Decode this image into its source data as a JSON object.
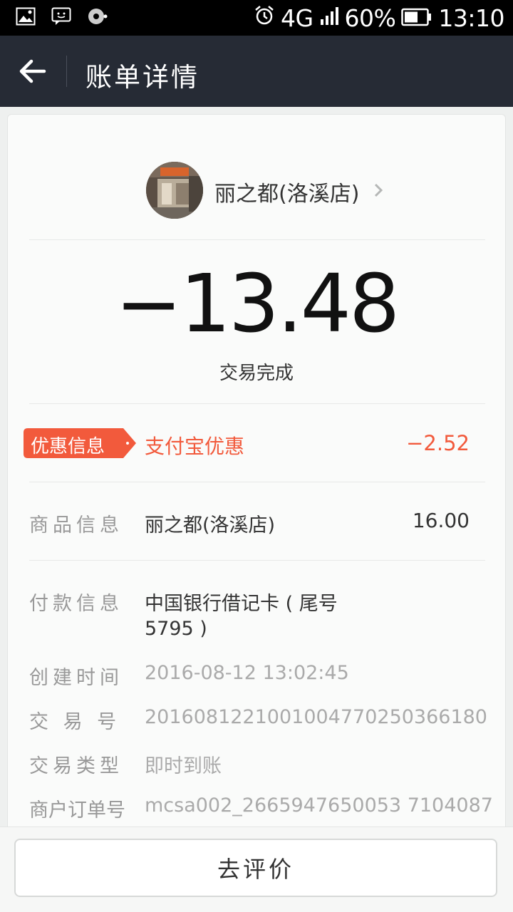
{
  "status_bar": {
    "network": "4G",
    "battery_percent": "60%",
    "time": "13:10",
    "icons": [
      "gallery-icon",
      "message-icon",
      "disk-icon",
      "alarm-icon",
      "signal-icon",
      "battery-icon"
    ]
  },
  "nav": {
    "title": "账单详情"
  },
  "merchant": {
    "name": "丽之都(洛溪店)"
  },
  "amount": "−13.48",
  "status": "交易完成",
  "promo": {
    "tag": "优惠信息",
    "source": "支付宝优惠",
    "amount": "−2.52"
  },
  "goods": {
    "label": "商品信息",
    "name": "丽之都(洛溪店)",
    "amount": "16.00"
  },
  "details": {
    "payment_label": "付款信息",
    "payment_line1": "中国银行借记卡 ( 尾号",
    "payment_line2": "5795 )",
    "created_label": "创建时间",
    "created_value": "2016-08-12 13:02:45",
    "trade_no_label": "交 易 号",
    "trade_no_value": "2016081221001004770250366180",
    "trade_type_label": "交易类型",
    "trade_type_value": "即时到账",
    "order_no_label": "商户订单号",
    "order_no_value": "mcsa002_2665947650053 7104087"
  },
  "action": {
    "rate_label": "去评价"
  },
  "colors": {
    "accent": "#f25a3c",
    "nav_bg": "#262b35"
  }
}
